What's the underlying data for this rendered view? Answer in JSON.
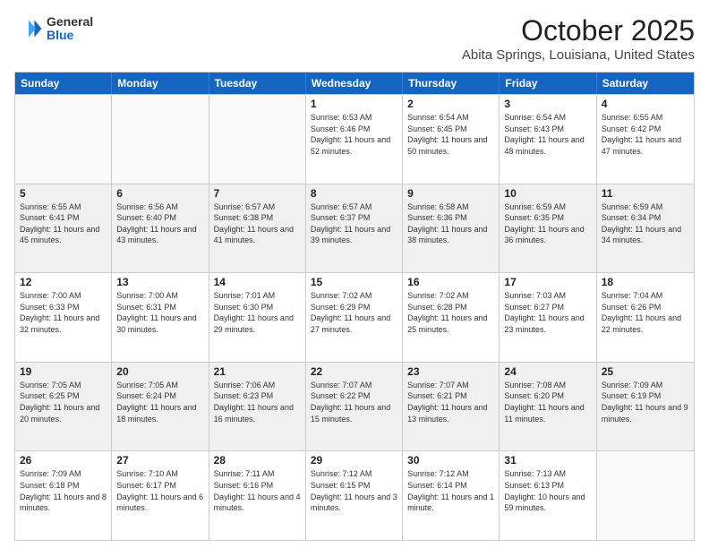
{
  "logo": {
    "general": "General",
    "blue": "Blue"
  },
  "header": {
    "month": "October 2025",
    "location": "Abita Springs, Louisiana, United States"
  },
  "days_of_week": [
    "Sunday",
    "Monday",
    "Tuesday",
    "Wednesday",
    "Thursday",
    "Friday",
    "Saturday"
  ],
  "weeks": [
    [
      {
        "day": "",
        "empty": true
      },
      {
        "day": "",
        "empty": true
      },
      {
        "day": "",
        "empty": true
      },
      {
        "day": "1",
        "sunrise": "6:53 AM",
        "sunset": "6:46 PM",
        "daylight": "11 hours and 52 minutes."
      },
      {
        "day": "2",
        "sunrise": "6:54 AM",
        "sunset": "6:45 PM",
        "daylight": "11 hours and 50 minutes."
      },
      {
        "day": "3",
        "sunrise": "6:54 AM",
        "sunset": "6:43 PM",
        "daylight": "11 hours and 48 minutes."
      },
      {
        "day": "4",
        "sunrise": "6:55 AM",
        "sunset": "6:42 PM",
        "daylight": "11 hours and 47 minutes."
      }
    ],
    [
      {
        "day": "5",
        "sunrise": "6:55 AM",
        "sunset": "6:41 PM",
        "daylight": "11 hours and 45 minutes."
      },
      {
        "day": "6",
        "sunrise": "6:56 AM",
        "sunset": "6:40 PM",
        "daylight": "11 hours and 43 minutes."
      },
      {
        "day": "7",
        "sunrise": "6:57 AM",
        "sunset": "6:38 PM",
        "daylight": "11 hours and 41 minutes."
      },
      {
        "day": "8",
        "sunrise": "6:57 AM",
        "sunset": "6:37 PM",
        "daylight": "11 hours and 39 minutes."
      },
      {
        "day": "9",
        "sunrise": "6:58 AM",
        "sunset": "6:36 PM",
        "daylight": "11 hours and 38 minutes."
      },
      {
        "day": "10",
        "sunrise": "6:59 AM",
        "sunset": "6:35 PM",
        "daylight": "11 hours and 36 minutes."
      },
      {
        "day": "11",
        "sunrise": "6:59 AM",
        "sunset": "6:34 PM",
        "daylight": "11 hours and 34 minutes."
      }
    ],
    [
      {
        "day": "12",
        "sunrise": "7:00 AM",
        "sunset": "6:33 PM",
        "daylight": "11 hours and 32 minutes."
      },
      {
        "day": "13",
        "sunrise": "7:00 AM",
        "sunset": "6:31 PM",
        "daylight": "11 hours and 30 minutes."
      },
      {
        "day": "14",
        "sunrise": "7:01 AM",
        "sunset": "6:30 PM",
        "daylight": "11 hours and 29 minutes."
      },
      {
        "day": "15",
        "sunrise": "7:02 AM",
        "sunset": "6:29 PM",
        "daylight": "11 hours and 27 minutes."
      },
      {
        "day": "16",
        "sunrise": "7:02 AM",
        "sunset": "6:28 PM",
        "daylight": "11 hours and 25 minutes."
      },
      {
        "day": "17",
        "sunrise": "7:03 AM",
        "sunset": "6:27 PM",
        "daylight": "11 hours and 23 minutes."
      },
      {
        "day": "18",
        "sunrise": "7:04 AM",
        "sunset": "6:26 PM",
        "daylight": "11 hours and 22 minutes."
      }
    ],
    [
      {
        "day": "19",
        "sunrise": "7:05 AM",
        "sunset": "6:25 PM",
        "daylight": "11 hours and 20 minutes."
      },
      {
        "day": "20",
        "sunrise": "7:05 AM",
        "sunset": "6:24 PM",
        "daylight": "11 hours and 18 minutes."
      },
      {
        "day": "21",
        "sunrise": "7:06 AM",
        "sunset": "6:23 PM",
        "daylight": "11 hours and 16 minutes."
      },
      {
        "day": "22",
        "sunrise": "7:07 AM",
        "sunset": "6:22 PM",
        "daylight": "11 hours and 15 minutes."
      },
      {
        "day": "23",
        "sunrise": "7:07 AM",
        "sunset": "6:21 PM",
        "daylight": "11 hours and 13 minutes."
      },
      {
        "day": "24",
        "sunrise": "7:08 AM",
        "sunset": "6:20 PM",
        "daylight": "11 hours and 11 minutes."
      },
      {
        "day": "25",
        "sunrise": "7:09 AM",
        "sunset": "6:19 PM",
        "daylight": "11 hours and 9 minutes."
      }
    ],
    [
      {
        "day": "26",
        "sunrise": "7:09 AM",
        "sunset": "6:18 PM",
        "daylight": "11 hours and 8 minutes."
      },
      {
        "day": "27",
        "sunrise": "7:10 AM",
        "sunset": "6:17 PM",
        "daylight": "11 hours and 6 minutes."
      },
      {
        "day": "28",
        "sunrise": "7:11 AM",
        "sunset": "6:16 PM",
        "daylight": "11 hours and 4 minutes."
      },
      {
        "day": "29",
        "sunrise": "7:12 AM",
        "sunset": "6:15 PM",
        "daylight": "11 hours and 3 minutes."
      },
      {
        "day": "30",
        "sunrise": "7:12 AM",
        "sunset": "6:14 PM",
        "daylight": "11 hours and 1 minute."
      },
      {
        "day": "31",
        "sunrise": "7:13 AM",
        "sunset": "6:13 PM",
        "daylight": "10 hours and 59 minutes."
      },
      {
        "day": "",
        "empty": true
      }
    ]
  ]
}
